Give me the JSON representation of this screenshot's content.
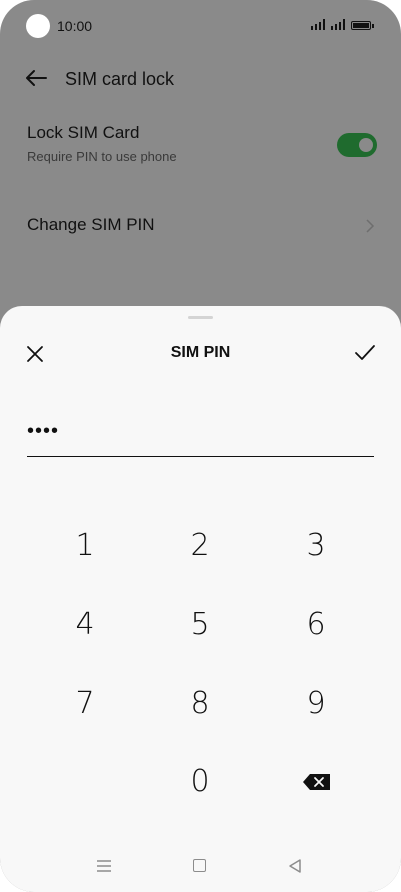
{
  "status_bar": {
    "time": "10:00"
  },
  "header": {
    "title": "SIM card lock"
  },
  "settings": {
    "lock_sim": {
      "label": "Lock SIM Card",
      "sublabel": "Require PIN to use phone",
      "enabled": true
    },
    "change_pin": {
      "label": "Change SIM PIN"
    }
  },
  "sheet": {
    "title": "SIM PIN",
    "pin_value": "••••"
  },
  "keypad": {
    "keys": [
      "1",
      "2",
      "3",
      "4",
      "5",
      "6",
      "7",
      "8",
      "9",
      "0"
    ]
  },
  "colors": {
    "toggle_on": "#1f6b2e",
    "overlay": "#8a8a8a",
    "sheet": "#f8f8f8"
  },
  "icons": [
    "back-arrow-icon",
    "chevron-right-icon",
    "close-icon",
    "check-icon",
    "backspace-icon",
    "nav-menu-icon",
    "nav-home-icon",
    "nav-back-icon"
  ]
}
